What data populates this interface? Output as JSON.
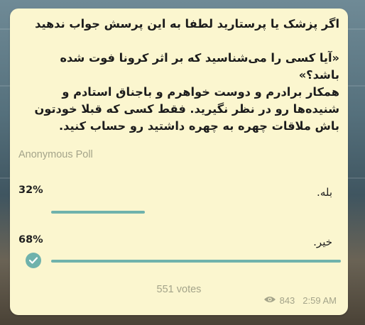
{
  "question": "اگر پزشک یا پرستارید لطفا به این پرسش جواب ندهید\n\n«آیا کسی را می‌شناسید که بر اثر کرونا فوت شده باشد؟»\nهمکار برادرم و دوست خواهرم و باجناق استادم و شنیده‌ها رو در نظر نگیرید. فقط کسی که قبلا خودتون باش ملاقات چهره به چهره داشتید رو حساب کنید.",
  "poll_type": "Anonymous Poll",
  "options": [
    {
      "label": "بله.",
      "percent_text": "32%",
      "percent": 32,
      "chosen": false
    },
    {
      "label": "خیر.",
      "percent_text": "68%",
      "percent": 68,
      "chosen": true
    }
  ],
  "votes_text": "551 votes",
  "view_count": "843",
  "time": "2:59 AM",
  "colors": {
    "bubble": "#fbf6cf",
    "accent": "#6fb2ac",
    "muted": "#a4a48a"
  },
  "icons": [
    "check-icon",
    "eye-icon"
  ]
}
